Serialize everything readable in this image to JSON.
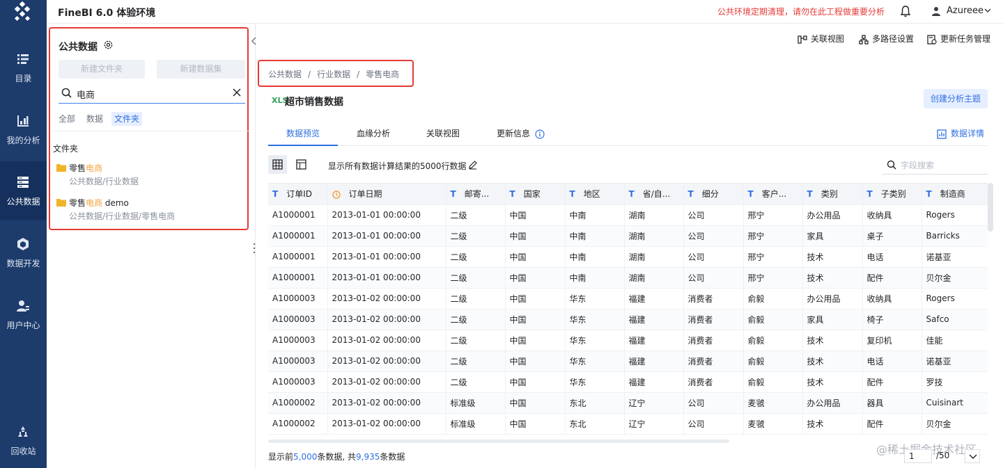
{
  "app": {
    "title": "FineBI 6.0 体验环境",
    "notice": "公共环境定期清理，请勿在此工程做重要分析",
    "user": "Azureee"
  },
  "nav": [
    {
      "label": "目录",
      "icon": "catalog-icon"
    },
    {
      "label": "我的分析",
      "icon": "analysis-icon"
    },
    {
      "label": "公共数据",
      "icon": "public-data-icon",
      "active": true
    },
    {
      "label": "数据开发",
      "icon": "data-dev-icon"
    },
    {
      "label": "用户中心",
      "icon": "user-center-icon"
    },
    {
      "label": "回收站",
      "icon": "recycle-bin-icon"
    }
  ],
  "panel": {
    "title": "公共数据",
    "new_folder": "新建文件夹",
    "new_dataset": "新建数据集",
    "search_value": "电商",
    "filter_tabs": [
      "全部",
      "数据",
      "文件夹"
    ],
    "section_title": "文件夹",
    "results": [
      {
        "name_prefix": "零售",
        "name_highlight": "电商",
        "name_suffix": "",
        "path": "公共数据/行业数据"
      },
      {
        "name_prefix": "零售",
        "name_highlight": "电商",
        "name_suffix": " demo",
        "path": "公共数据/行业数据/零售电商"
      }
    ]
  },
  "toolbar": {
    "relation_view": "关联视图",
    "multi_path": "多路径设置",
    "update_task": "更新任务管理"
  },
  "breadcrumb": [
    "公共数据",
    "/",
    "行业数据",
    "/",
    "零售电商"
  ],
  "dataset": {
    "file_badge": "XLS",
    "title": "超市销售数据",
    "create_topic": "创建分析主题"
  },
  "tabs": [
    "数据预览",
    "血缘分析",
    "关联视图",
    "更新信息"
  ],
  "data_detail": "数据详情",
  "compute_info": "显示所有数据计算结果的5000行数据",
  "field_search_placeholder": "字段搜索",
  "table": {
    "columns": [
      {
        "type": "T",
        "label": "订单ID"
      },
      {
        "type": "date",
        "label": "订单日期"
      },
      {
        "type": "T",
        "label": "邮寄..."
      },
      {
        "type": "T",
        "label": "国家"
      },
      {
        "type": "T",
        "label": "地区"
      },
      {
        "type": "T",
        "label": "省/自..."
      },
      {
        "type": "T",
        "label": "细分"
      },
      {
        "type": "T",
        "label": "客户..."
      },
      {
        "type": "T",
        "label": "类别"
      },
      {
        "type": "T",
        "label": "子类别"
      },
      {
        "type": "T",
        "label": "制造商"
      }
    ],
    "rows": [
      [
        "A1000001",
        "2013-01-01 00:00:00",
        "二级",
        "中国",
        "中南",
        "湖南",
        "公司",
        "邢宁",
        "办公用品",
        "收纳具",
        "Rogers"
      ],
      [
        "A1000001",
        "2013-01-01 00:00:00",
        "二级",
        "中国",
        "中南",
        "湖南",
        "公司",
        "邢宁",
        "家具",
        "桌子",
        "Barricks"
      ],
      [
        "A1000001",
        "2013-01-01 00:00:00",
        "二级",
        "中国",
        "中南",
        "湖南",
        "公司",
        "邢宁",
        "技术",
        "电话",
        "诺基亚"
      ],
      [
        "A1000001",
        "2013-01-01 00:00:00",
        "二级",
        "中国",
        "中南",
        "湖南",
        "公司",
        "邢宁",
        "技术",
        "配件",
        "贝尔金"
      ],
      [
        "A1000003",
        "2013-01-02 00:00:00",
        "二级",
        "中国",
        "华东",
        "福建",
        "消费者",
        "俞毅",
        "办公用品",
        "收纳具",
        "Rogers"
      ],
      [
        "A1000003",
        "2013-01-02 00:00:00",
        "二级",
        "中国",
        "华东",
        "福建",
        "消费者",
        "俞毅",
        "家具",
        "椅子",
        "Safco"
      ],
      [
        "A1000003",
        "2013-01-02 00:00:00",
        "二级",
        "中国",
        "华东",
        "福建",
        "消费者",
        "俞毅",
        "技术",
        "复印机",
        "佳能"
      ],
      [
        "A1000003",
        "2013-01-02 00:00:00",
        "二级",
        "中国",
        "华东",
        "福建",
        "消费者",
        "俞毅",
        "技术",
        "电话",
        "诺基亚"
      ],
      [
        "A1000003",
        "2013-01-02 00:00:00",
        "二级",
        "中国",
        "华东",
        "福建",
        "消费者",
        "俞毅",
        "技术",
        "配件",
        "罗技"
      ],
      [
        "A1000002",
        "2013-01-02 00:00:00",
        "标准级",
        "中国",
        "东北",
        "辽宁",
        "公司",
        "麦虢",
        "办公用品",
        "器具",
        "Cuisinart"
      ],
      [
        "A1000002",
        "2013-01-02 00:00:00",
        "标准级",
        "中国",
        "东北",
        "辽宁",
        "公司",
        "麦虢",
        "技术",
        "配件",
        "贝尔金"
      ]
    ]
  },
  "footer": {
    "prefix": "显示前",
    "shown": "5,000",
    "mid": "条数据, 共",
    "total": "9,935",
    "suffix": "条数据"
  },
  "pagination": {
    "page": "1",
    "total": "/50"
  },
  "credit": "@稀土掘金技术社区",
  "colors": {
    "nav_bg": "#1d3b6b",
    "accent": "#2f6fe0",
    "highlight": "#e53935"
  }
}
